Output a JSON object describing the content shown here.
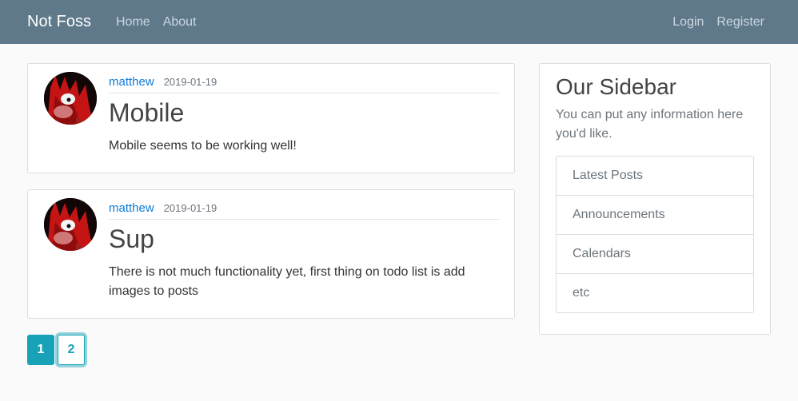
{
  "navbar": {
    "brand": "Not Foss",
    "left_links": [
      "Home",
      "About"
    ],
    "right_links": [
      "Login",
      "Register"
    ],
    "bg_color": "#5f788a"
  },
  "posts": [
    {
      "author": "matthew",
      "date": "2019-01-19",
      "title": "Mobile",
      "content": "Mobile seems to be working well!",
      "avatar_icon": "red-cartoon-character-avatar"
    },
    {
      "author": "matthew",
      "date": "2019-01-19",
      "title": "Sup",
      "content": "There is not much functionality yet, first thing on todo list is add images to posts",
      "avatar_icon": "red-cartoon-character-avatar"
    }
  ],
  "pagination": {
    "pages": [
      "1",
      "2"
    ],
    "current": "1",
    "accent_color": "#17a2b8"
  },
  "sidebar": {
    "title": "Our Sidebar",
    "text": "You can put any information here you'd like.",
    "items": [
      "Latest Posts",
      "Announcements",
      "Calendars",
      "etc"
    ]
  }
}
